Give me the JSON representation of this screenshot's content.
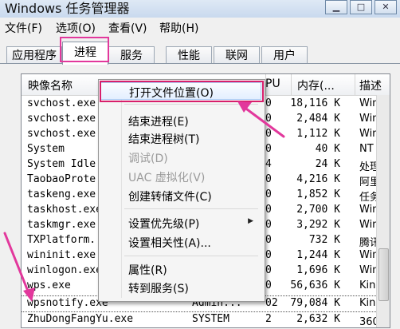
{
  "window": {
    "title": "Windows 任务管理器",
    "min_glyph": "▁",
    "max_glyph": "□",
    "close_glyph": "✕"
  },
  "menubar": [
    "文件(F)",
    "选项(O)",
    "查看(V)",
    "帮助(H)"
  ],
  "tabs": [
    {
      "label": "应用程序",
      "active": false
    },
    {
      "label": "进程",
      "active": true
    },
    {
      "label": "服务",
      "active": false
    },
    {
      "label": "性能",
      "active": false
    },
    {
      "label": "联网",
      "active": false
    },
    {
      "label": "用户",
      "active": false
    }
  ],
  "columns": {
    "image_name": "映像名称",
    "cpu": "PU",
    "memory": "内存(...",
    "description": "描述"
  },
  "processes": [
    {
      "name": "svchost.exe",
      "user": "",
      "cpu": "0",
      "mem": "18,116 K",
      "desc": "Wind"
    },
    {
      "name": "svchost.exe",
      "user": "",
      "cpu": "0",
      "mem": "2,484 K",
      "desc": "Wind"
    },
    {
      "name": "svchost.exe",
      "user": "",
      "cpu": "0",
      "mem": "1,112 K",
      "desc": "Wind"
    },
    {
      "name": "System",
      "user": "",
      "cpu": "0",
      "mem": "40 K",
      "desc": "NT K"
    },
    {
      "name": "System Idle",
      "user": "",
      "cpu": "4",
      "mem": "24 K",
      "desc": "处理器"
    },
    {
      "name": "TaobaoProte",
      "user": "",
      "cpu": "0",
      "mem": "4,216 K",
      "desc": "阿里"
    },
    {
      "name": "taskeng.exe",
      "user": "",
      "cpu": "0",
      "mem": "1,852 K",
      "desc": "任务"
    },
    {
      "name": "taskhost.exe",
      "user": "",
      "cpu": "0",
      "mem": "2,700 K",
      "desc": "Wind"
    },
    {
      "name": "taskmgr.exe",
      "user": "",
      "cpu": "0",
      "mem": "3,292 K",
      "desc": "Wind"
    },
    {
      "name": "TXPlatform.",
      "user": "",
      "cpu": "0",
      "mem": "732 K",
      "desc": "腾讯"
    },
    {
      "name": "wininit.exe",
      "user": "",
      "cpu": "0",
      "mem": "1,244 K",
      "desc": "Wind"
    },
    {
      "name": "winlogon.exe",
      "user": "",
      "cpu": "0",
      "mem": "1,696 K",
      "desc": "Wind"
    },
    {
      "name": "wps.exe",
      "user": "",
      "cpu": "0",
      "mem": "56,636 K",
      "desc": "King"
    },
    {
      "name": "wpsnotify.exe",
      "user": "Admin...",
      "cpu": "02",
      "mem": "79,084 K",
      "desc": "King"
    },
    {
      "name": "ZhuDongFangYu.exe",
      "user": "SYSTEM",
      "cpu": "2",
      "mem": "2,632 K",
      "desc": "360主"
    }
  ],
  "context_menu": {
    "items": [
      {
        "label": "打开文件位置(O)",
        "disabled": false,
        "highlighted": true
      },
      {
        "label": "结束进程(E)",
        "disabled": false
      },
      {
        "label": "结束进程树(T)",
        "disabled": false
      },
      {
        "label": "调试(D)",
        "disabled": true
      },
      {
        "label": "UAC 虚拟化(V)",
        "disabled": true
      },
      {
        "label": "创建转储文件(C)",
        "disabled": false
      },
      {
        "label": "设置优先级(P)",
        "disabled": false,
        "submenu": true
      },
      {
        "label": "设置相关性(A)...",
        "disabled": false
      },
      {
        "label": "属性(R)",
        "disabled": false
      },
      {
        "label": "转到服务(S)",
        "disabled": false
      }
    ],
    "submenu_arrow": "▶"
  },
  "colors": {
    "annotation_pink": "#e2389c",
    "annotation_red": "#d81f6b"
  }
}
